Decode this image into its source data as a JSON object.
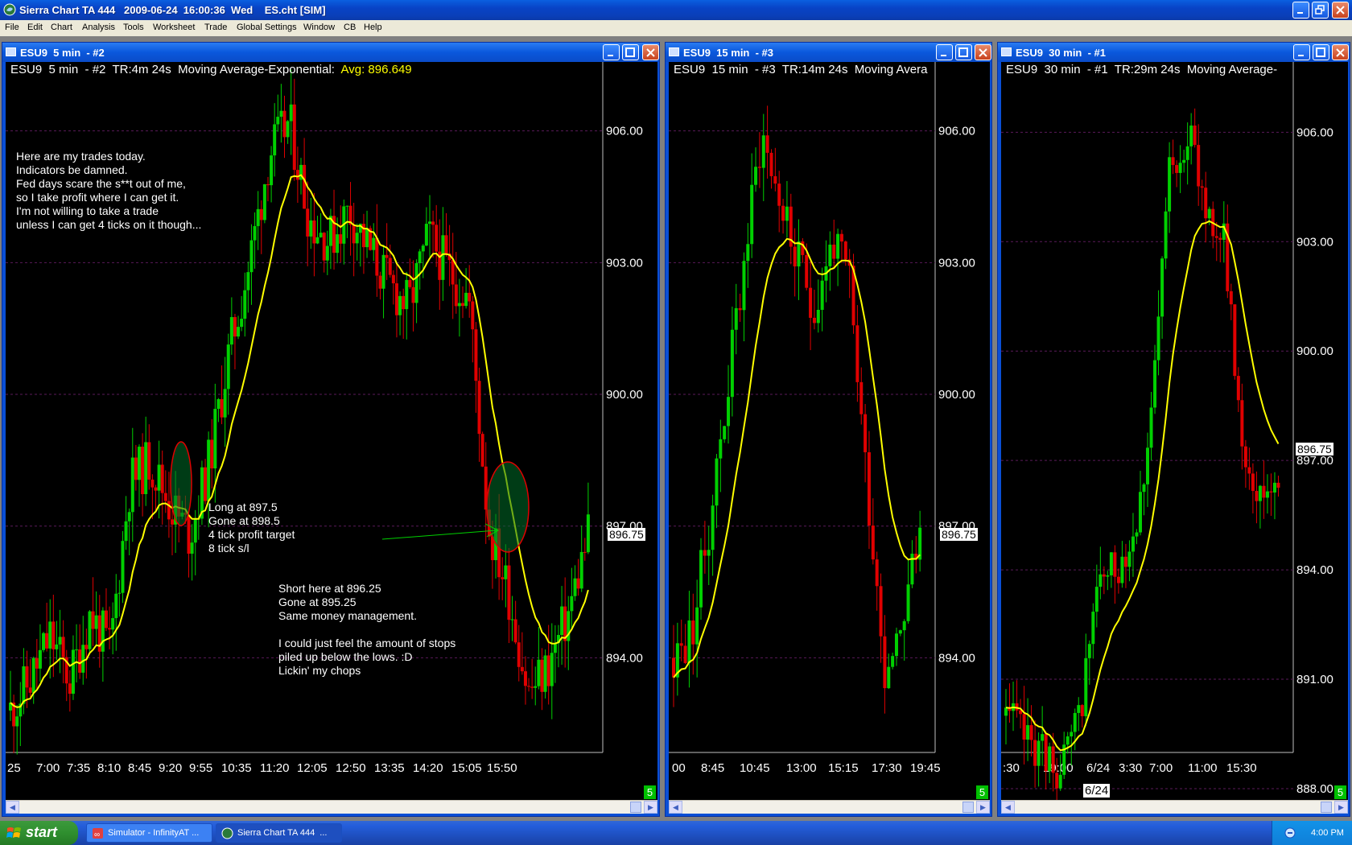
{
  "app": {
    "title": "Sierra Chart TA 444   2009-06-24  16:00:36  Wed    ES.cht [SIM]",
    "menu": [
      "File",
      "Edit",
      "Chart",
      "Analysis",
      "Tools",
      "Worksheet",
      "Trade",
      "Global Settings",
      "Window",
      "CB",
      "Help"
    ]
  },
  "colors": {
    "up_bar": "#00d000",
    "down_bar": "#e00000",
    "ema": "#ffff00",
    "grid": "#5a1a5a",
    "badge": "#00c000"
  },
  "charts": [
    {
      "window_title": "ESU9  5 min  - #2",
      "header": "ESU9  5 min  - #2  TR:4m 24s  Moving Average-Exponential:",
      "avg_label": "Avg: 896.649",
      "y_ticks": [
        "906.00",
        "903.00",
        "900.00",
        "897.00",
        "894.00"
      ],
      "x_ticks": [
        "25",
        "7:00",
        "7:35",
        "8:10",
        "8:45",
        "9:20",
        "9:55",
        "10:35",
        "11:20",
        "12:05",
        "12:50",
        "13:35",
        "14:20",
        "15:05",
        "15:50"
      ],
      "last_price": "896.75",
      "badge": "5",
      "notes": {
        "main": "Here are my trades today.\nIndicators be damned.\nFed days scare the s**t out of me,\nso I take profit where I can get it.\nI'm not willing to take a trade\nunless I can get 4 ticks on it though...",
        "long": "Long at 897.5\nGone at 898.5\n4 tick profit target\n8 tick s/l",
        "short": "Short here at 896.25\nGone at 895.25\nSame money management.\n\nI could just feel the amount of stops\npiled up below the lows. :D\nLickin' my chops"
      },
      "chart_data": {
        "type": "candlestick",
        "ema_values": [
          892.7,
          893.3,
          893.9,
          894.0,
          894.2,
          894.4,
          896.2,
          896.8,
          897.2,
          897.8,
          899.0,
          901.0,
          902.6,
          903.8,
          903.7,
          903.4,
          903.0,
          903.1,
          903.2,
          902.9,
          901.0,
          898.5,
          897.0,
          896.6
        ]
      }
    },
    {
      "window_title": "ESU9  15 min  - #3",
      "header": "ESU9  15 min  - #3  TR:14m 24s  Moving Avera",
      "y_ticks": [
        "906.00",
        "903.00",
        "900.00",
        "897.00",
        "894.00"
      ],
      "x_ticks": [
        "00",
        "8:45",
        "10:45",
        "13:00",
        "15:15",
        "17:30",
        "19:45"
      ],
      "last_price": "896.75",
      "badge": "5"
    },
    {
      "window_title": "ESU9  30 min  - #1",
      "header": "ESU9  30 min  - #1  TR:29m 24s  Moving Average-",
      "y_ticks": [
        "906.00",
        "903.00",
        "900.00",
        "897.00",
        "894.00",
        "891.00",
        "888.00"
      ],
      "x_ticks": [
        ":30",
        "19:00",
        "6/24",
        "3:30",
        "7:00",
        "11:00",
        "15:30"
      ],
      "last_price": "896.75",
      "badge": "5"
    }
  ],
  "taskbar": {
    "start": "start",
    "tasks": [
      "Simulator - InfinityAT ...",
      "Sierra Chart TA 444  ..."
    ],
    "clock": "4:00 PM"
  }
}
